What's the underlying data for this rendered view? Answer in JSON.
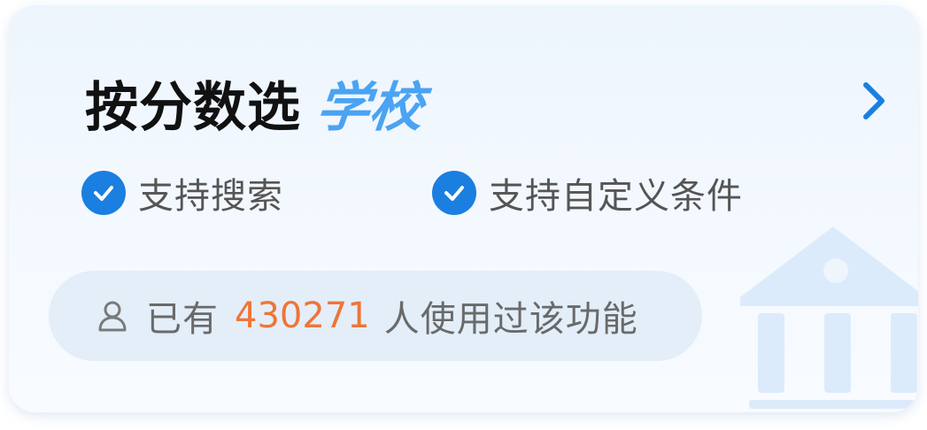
{
  "card": {
    "title_main": "按分数选",
    "title_accent": "学校",
    "features": [
      {
        "label": "支持搜索"
      },
      {
        "label": "支持自定义条件"
      }
    ],
    "usage": {
      "prefix": "已有",
      "count": "430271",
      "suffix": "人使用过该功能"
    }
  },
  "icons": {
    "arrow": "chevron-right-icon",
    "check": "check-circle-icon",
    "user": "user-icon",
    "watermark": "school-building-icon"
  },
  "colors": {
    "accent_blue": "#4aa3f3",
    "check_blue": "#1a7fe0",
    "count_orange": "#f07436",
    "title_black": "#111111"
  }
}
